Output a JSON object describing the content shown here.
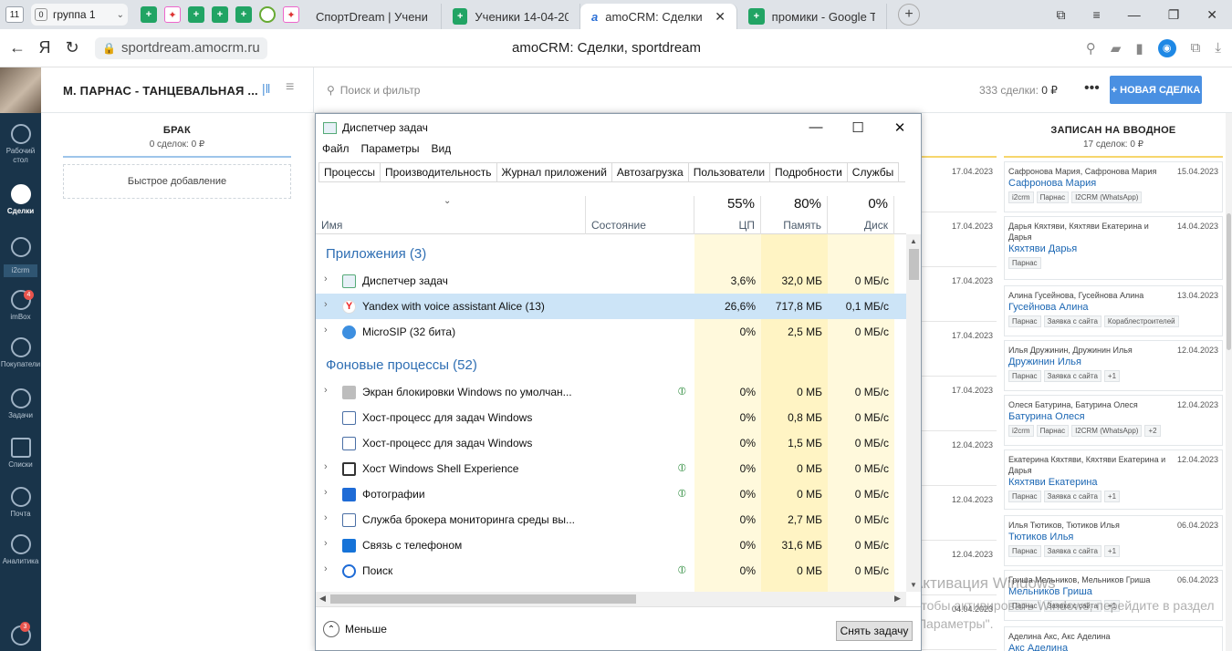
{
  "browser": {
    "tab_count": "11",
    "group": {
      "count": "0",
      "label": "группа 1"
    },
    "tabs": [
      {
        "title": "СпортDream | Учени",
        "icon": "sport-icon"
      },
      {
        "title": "Ученики 14-04-202",
        "icon": "sheet-icon"
      },
      {
        "title": "amoCRM: Сделки",
        "icon": "amo-icon"
      },
      {
        "title": "промики - Google T",
        "icon": "sheet-icon"
      }
    ],
    "url": "sportdream.amocrm.ru",
    "page_title": "amoCRM: Сделки, sportdream"
  },
  "nav": {
    "items": [
      {
        "label": "Рабочий стол",
        "icon": "dashboard-icon"
      },
      {
        "label": "Сделки",
        "icon": "deals-icon"
      },
      {
        "label": "i2crm",
        "icon": "i2crm-icon"
      },
      {
        "label": "imBox",
        "icon": "chat-icon",
        "badge": "4"
      },
      {
        "label": "Покупатели",
        "icon": "customers-icon"
      },
      {
        "label": "Задачи",
        "icon": "tasks-icon"
      },
      {
        "label": "Списки",
        "icon": "lists-icon"
      },
      {
        "label": "Почта",
        "icon": "mail-icon"
      },
      {
        "label": "Аналитика",
        "icon": "analytics-icon"
      }
    ],
    "bottom_badge": "3"
  },
  "header": {
    "pipeline": "М. ПАРНАС - ТАНЦЕВАЛЬНАЯ ...",
    "search_placeholder": "Поиск и фильтр",
    "deals_count": "333 сделки:",
    "deals_sum": "0 ₽",
    "more": "•••",
    "new_deal": "+ НОВАЯ СДЕЛКА"
  },
  "columns": {
    "brak": {
      "name": "БРАК",
      "summary": "0 сделок: 0 ₽",
      "quick_add": "Быстрое добавление"
    },
    "zapisan": {
      "name": "ЗАПИСАН НА ВВОДНОЕ",
      "summary": "17 сделок: 0 ₽"
    }
  },
  "mid_dates": [
    "17.04.2023",
    "17.04.2023",
    "17.04.2023",
    "17.04.2023",
    "17.04.2023",
    "12.04.2023",
    "12.04.2023",
    "12.04.2023",
    "04.04.2023"
  ],
  "cards": [
    {
      "contact": "Сафронова Мария, Сафронова Мария",
      "date": "15.04.2023",
      "name": "Сафронова Мария",
      "tags": [
        "i2crm",
        "Парнас",
        "I2CRM (WhatsApp)"
      ]
    },
    {
      "contact": "Дарья Кяхтяви, Кяхтяви Екатерина и Дарья",
      "date": "14.04.2023",
      "name": "Кяхтяви Дарья",
      "tags": [
        "Парнас"
      ]
    },
    {
      "contact": "Алина Гусейнова, Гусейнова Алина",
      "date": "13.04.2023",
      "name": "Гусейнова Алина",
      "tags": [
        "Парнас",
        "Заявка с сайта",
        "Кораблестроителей"
      ]
    },
    {
      "contact": "Илья Дружинин, Дружинин Илья",
      "date": "12.04.2023",
      "name": "Дружинин Илья",
      "tags": [
        "Парнас",
        "Заявка с сайта",
        "+1"
      ]
    },
    {
      "contact": "Олеся Батурина, Батурина Олеся",
      "date": "12.04.2023",
      "name": "Батурина Олеся",
      "tags": [
        "i2crm",
        "Парнас",
        "I2CRM (WhatsApp)",
        "+2"
      ]
    },
    {
      "contact": "Екатерина Кяхтяви, Кяхтяви Екатерина и Дарья",
      "date": "12.04.2023",
      "name": "Кяхтяви Екатерина",
      "tags": [
        "Парнас",
        "Заявка с сайта",
        "+1"
      ]
    },
    {
      "contact": "Илья Тютиков, Тютиков Илья",
      "date": "06.04.2023",
      "name": "Тютиков Илья",
      "tags": [
        "Парнас",
        "Заявка с сайта",
        "+1"
      ]
    },
    {
      "contact": "Гриша Мельников, Мельников Гриша",
      "date": "06.04.2023",
      "name": "Мельников Гриша",
      "tags": [
        "Парнас",
        "Заявка с сайта",
        "+1"
      ]
    },
    {
      "contact": "Аделина Акс, Акс Аделина",
      "date": "",
      "name": "Акс Аделина",
      "tags": []
    }
  ],
  "watermark": {
    "title": "Активация Windows",
    "text": "Чтобы активировать Windows, перейдите в раздел \"Параметры\"."
  },
  "taskmgr": {
    "title": "Диспетчер задач",
    "menu": [
      "Файл",
      "Параметры",
      "Вид"
    ],
    "tabs": [
      "Процессы",
      "Производительность",
      "Журнал приложений",
      "Автозагрузка",
      "Пользователи",
      "Подробности",
      "Службы"
    ],
    "columns": {
      "name": "Имя",
      "status": "Состояние",
      "cpu": {
        "pct": "55%",
        "label": "ЦП"
      },
      "mem": {
        "pct": "80%",
        "label": "Память"
      },
      "disk": {
        "pct": "0%",
        "label": "Диск"
      }
    },
    "groups": {
      "apps": "Приложения (3)",
      "background": "Фоновые процессы (52)"
    },
    "apps": [
      {
        "name": "Диспетчер задач",
        "cpu": "3,6%",
        "mem": "32,0 МБ",
        "disk": "0 МБ/с",
        "icon": "taskmgr-icon"
      },
      {
        "name": "Yandex with voice assistant Alice (13)",
        "cpu": "26,6%",
        "mem": "717,8 МБ",
        "disk": "0,1 МБ/с",
        "icon": "yandex-icon",
        "selected": true
      },
      {
        "name": "MicroSIP (32 бита)",
        "cpu": "0%",
        "mem": "2,5 МБ",
        "disk": "0 МБ/с",
        "icon": "microsip-icon"
      }
    ],
    "background": [
      {
        "name": "Экран блокировки Windows по умолчан...",
        "cpu": "0%",
        "mem": "0 МБ",
        "disk": "0 МБ/с",
        "expand": true,
        "leaf": true,
        "icon": "lockscreen-icon"
      },
      {
        "name": "Хост-процесс для задач Windows",
        "cpu": "0%",
        "mem": "0,8 МБ",
        "disk": "0 МБ/с",
        "expand": false,
        "leaf": false,
        "icon": "host-icon"
      },
      {
        "name": "Хост-процесс для задач Windows",
        "cpu": "0%",
        "mem": "1,5 МБ",
        "disk": "0 МБ/с",
        "expand": false,
        "leaf": false,
        "icon": "host-icon"
      },
      {
        "name": "Хост Windows Shell Experience",
        "cpu": "0%",
        "mem": "0 МБ",
        "disk": "0 МБ/с",
        "expand": true,
        "leaf": true,
        "icon": "shell-icon"
      },
      {
        "name": "Фотографии",
        "cpu": "0%",
        "mem": "0 МБ",
        "disk": "0 МБ/с",
        "expand": true,
        "leaf": true,
        "icon": "photos-icon"
      },
      {
        "name": "Служба брокера мониторинга среды вы...",
        "cpu": "0%",
        "mem": "2,7 МБ",
        "disk": "0 МБ/с",
        "expand": true,
        "leaf": false,
        "icon": "host-icon"
      },
      {
        "name": "Связь с телефоном",
        "cpu": "0%",
        "mem": "31,6 МБ",
        "disk": "0 МБ/с",
        "expand": true,
        "leaf": false,
        "icon": "phone-icon"
      },
      {
        "name": "Поиск",
        "cpu": "0%",
        "mem": "0 МБ",
        "disk": "0 МБ/с",
        "expand": true,
        "leaf": true,
        "icon": "search-icon"
      }
    ],
    "less": "Меньше",
    "end_task": "Снять задачу"
  }
}
